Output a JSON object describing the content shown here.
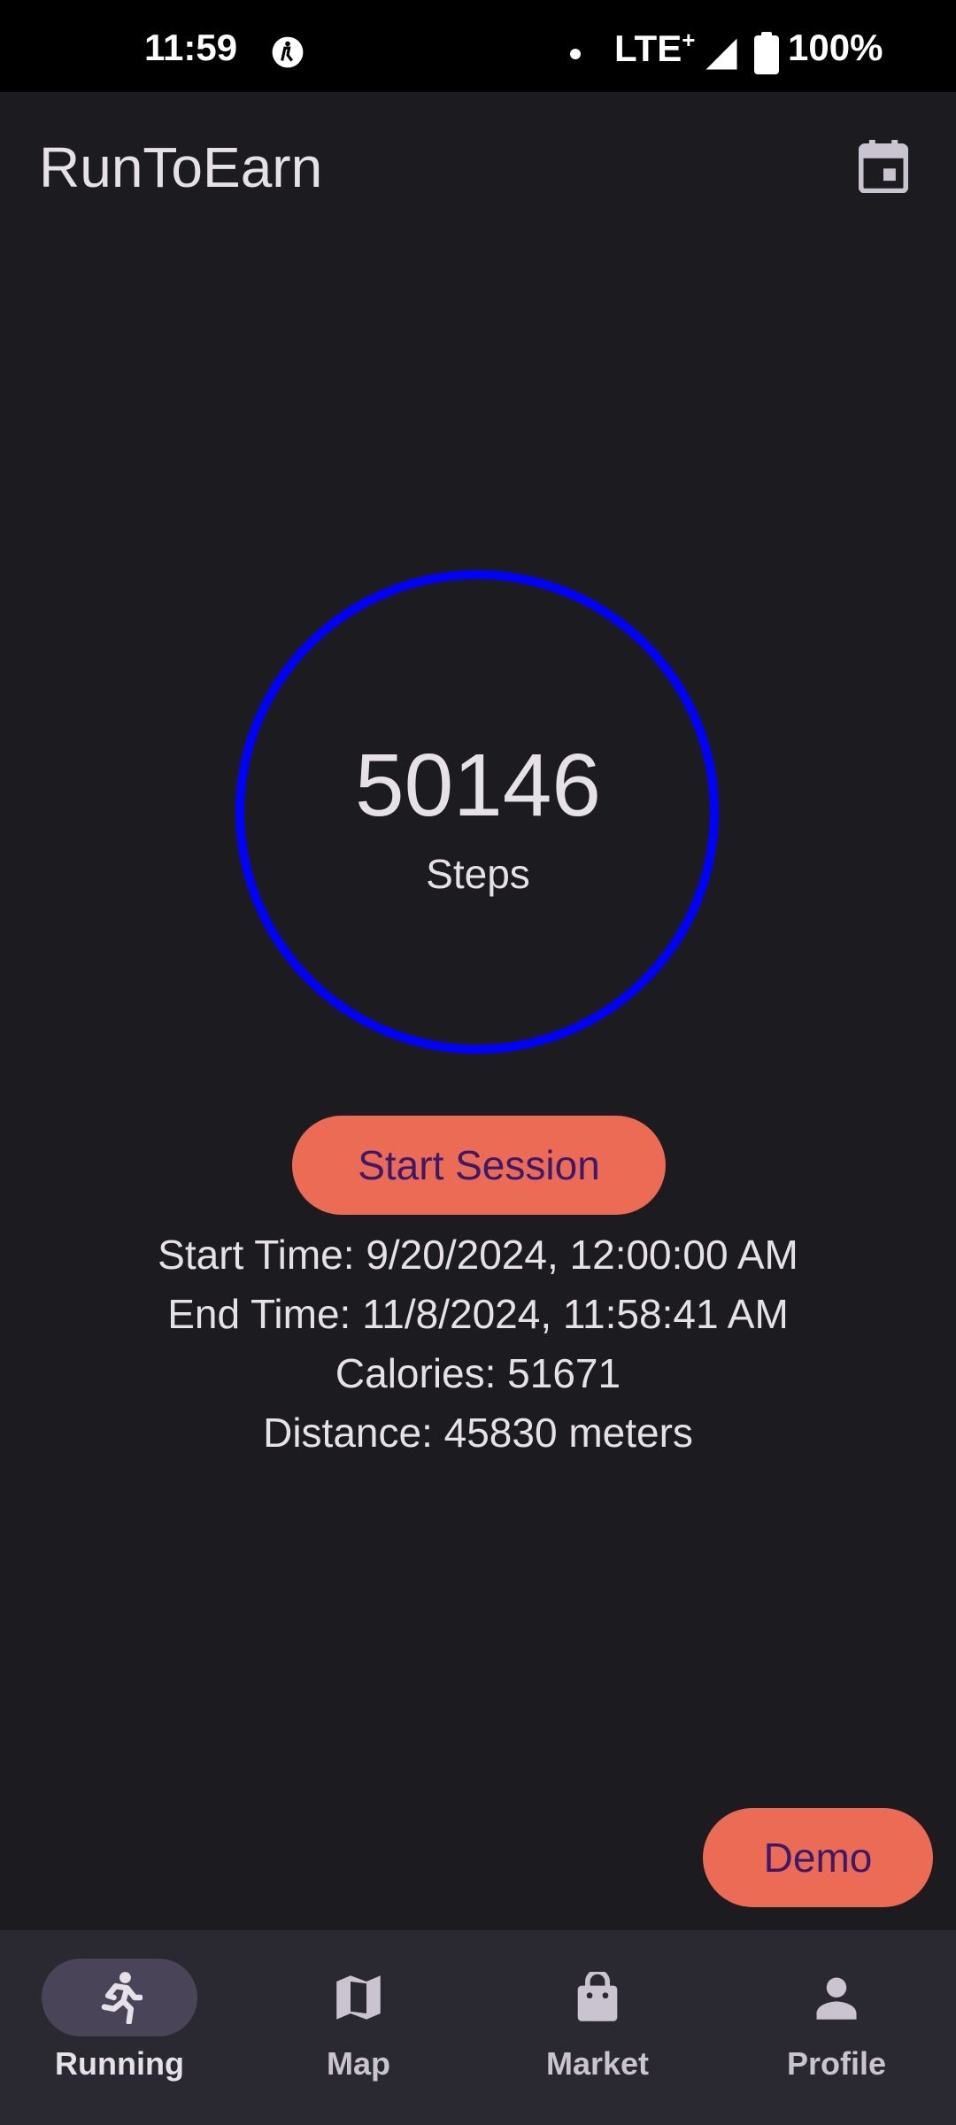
{
  "status_bar": {
    "time": "11:59",
    "network": "LTE",
    "network_sup": "+",
    "battery": "100%"
  },
  "app_bar": {
    "title": "RunToEarn",
    "action_icon": "calendar-icon"
  },
  "steps": {
    "value": "50146",
    "label": "Steps",
    "ring_color": "#0000ff"
  },
  "session": {
    "button_label": "Start Session",
    "start_time": "Start Time: 9/20/2024, 12:00:00 AM",
    "end_time": "End Time: 11/8/2024, 11:58:41 AM",
    "calories": "Calories: 51671",
    "distance": "Distance: 45830 meters"
  },
  "demo_button": {
    "label": "Demo"
  },
  "accent_color": "#ec6b55",
  "bottom_nav": {
    "items": [
      {
        "label": "Running",
        "icon": "running-icon",
        "active": true
      },
      {
        "label": "Map",
        "icon": "map-icon",
        "active": false
      },
      {
        "label": "Market",
        "icon": "shopping-bag-icon",
        "active": false
      },
      {
        "label": "Profile",
        "icon": "person-icon",
        "active": false
      }
    ]
  }
}
